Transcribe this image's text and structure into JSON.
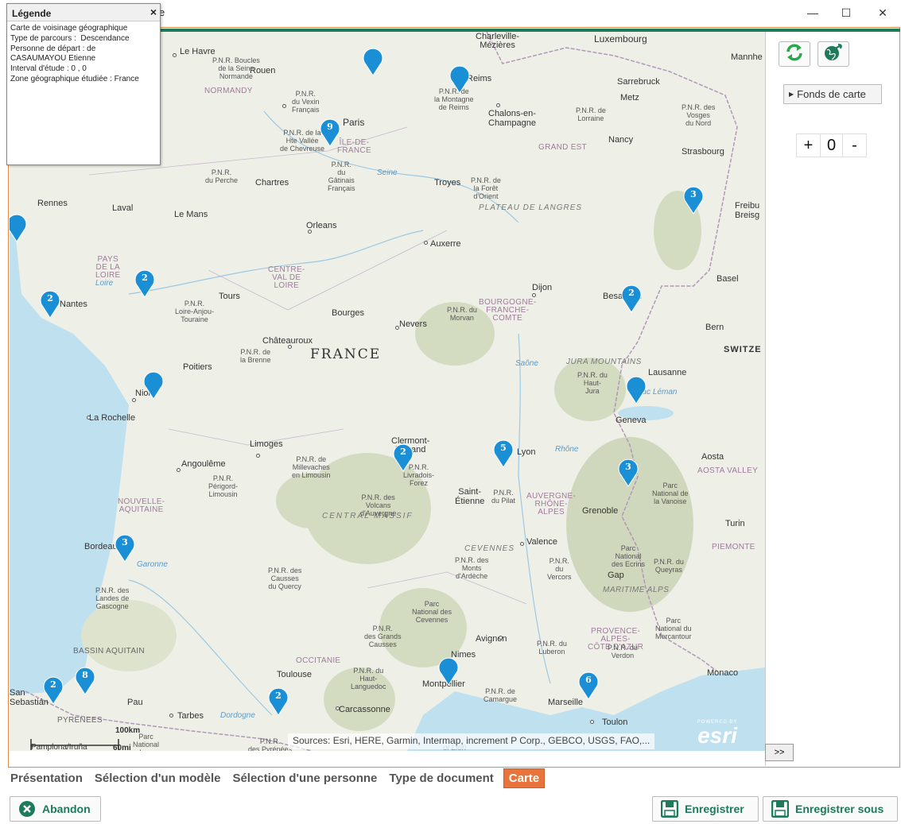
{
  "window": {
    "title_fragment": "e",
    "controls": {
      "minimize": "—",
      "maximize": "☐",
      "close": "✕"
    }
  },
  "legend": {
    "title": "Légende",
    "close": "×",
    "lines": [
      "Carte de voisinage géographique",
      "Type de parcours :  Descendance",
      "Personne de départ : de",
      "CASAUMAYOU Etienne",
      "Interval d'étude : 0 , 0",
      "Zone géographique étudiée : France"
    ]
  },
  "map": {
    "country_label": "FRANCE",
    "neighbour_label": "SWITZE",
    "cities": [
      {
        "name": "Charleville-\nMézières"
      },
      {
        "name": "Luxembourg"
      },
      {
        "name": "Le Havre"
      },
      {
        "name": "Rouen"
      },
      {
        "name": "Reims"
      },
      {
        "name": "Sarrebruck"
      },
      {
        "name": "Mannhe"
      },
      {
        "name": "Metz"
      },
      {
        "name": "Chalons-en-\nChampagne"
      },
      {
        "name": "Paris"
      },
      {
        "name": "Nancy"
      },
      {
        "name": "Strasbourg"
      },
      {
        "name": "Chartres"
      },
      {
        "name": "Troyes"
      },
      {
        "name": "Rennes"
      },
      {
        "name": "Laval"
      },
      {
        "name": "Le Mans"
      },
      {
        "name": "Orleans"
      },
      {
        "name": "Freibu\nBreisg"
      },
      {
        "name": "Auxerre"
      },
      {
        "name": "Basel"
      },
      {
        "name": "Nantes"
      },
      {
        "name": "Tours"
      },
      {
        "name": "Dijon"
      },
      {
        "name": "Besançon"
      },
      {
        "name": "Bourges"
      },
      {
        "name": "Nevers"
      },
      {
        "name": "Bern"
      },
      {
        "name": "Châteauroux"
      },
      {
        "name": "Poitiers"
      },
      {
        "name": "Lausanne"
      },
      {
        "name": "Niort"
      },
      {
        "name": "La Rochelle"
      },
      {
        "name": "Geneva"
      },
      {
        "name": "Limoges"
      },
      {
        "name": "Clermont-\nFerrand"
      },
      {
        "name": "Lyon"
      },
      {
        "name": "Angoulême"
      },
      {
        "name": "Saint-\nÉtienne"
      },
      {
        "name": "Aosta"
      },
      {
        "name": "Grenoble"
      },
      {
        "name": "Turin"
      },
      {
        "name": "Bordeaux"
      },
      {
        "name": "Valence"
      },
      {
        "name": "Gap"
      },
      {
        "name": "Avignon"
      },
      {
        "name": "Nimes"
      },
      {
        "name": "Monaco"
      },
      {
        "name": "Toulouse"
      },
      {
        "name": "Montpellier"
      },
      {
        "name": "Pau"
      },
      {
        "name": "Marseille"
      },
      {
        "name": "Carcassonne"
      },
      {
        "name": "Toulon"
      },
      {
        "name": "Tarbes"
      },
      {
        "name": "San\nSebastián"
      },
      {
        "name": "Pamplona/Iruña"
      },
      {
        "name": "Nantes-left"
      }
    ],
    "regions": [
      "NORMANDY",
      "ÎLE-DE-\nFRANCE",
      "GRAND EST",
      "PAYS\nDE LA\nLOIRE",
      "CENTRE-\nVAL DE\nLOIRE",
      "BOURGOGNE-\nFRANCHE-\nCOMTE",
      "NOUVELLE-\nAQUITAINE",
      "AUVERGNE-\nRHÔNE-\nALPES",
      "OCCITANIE",
      "PROVENCE-\nALPES-\nCÔTE D'AZUR",
      "AOSTA VALLEY",
      "PIEMONTE",
      "PYRENEES",
      "BASSIN AQUITAIN"
    ],
    "features": [
      "PLATEAU DE LANGRES",
      "CENTRAL  MASSIF",
      "JURA MOUNTAINS",
      "CEVENNES",
      "MARITIME ALPS",
      "Seine",
      "Loire",
      "Garonne",
      "Saône",
      "Rhône",
      "Dordogne",
      "Lac Léman"
    ],
    "parks": [
      "P.N.R. Boucles\nde la Seine\nNormande",
      "P.N.R.\ndu Vexin\nFrançais",
      "P.N.R. de\nla Montagne\nde Reims",
      "P.N.R. de\nLorraine",
      "P.N.R. des\nVosges\ndu Nord",
      "P.N.R. de la\nHte Vallée\nde Chevreuse",
      "P.N.R.\ndu Perche",
      "P.N.R.\ndu\nGâtinais\nFrançais",
      "P.N.R. de\nla Forêt\nd'Orient",
      "P.N.R.\nLoire-Anjou-\nTouraine",
      "P.N.R. du\nMorvan",
      "P.N.R. de\nla Brenne",
      "P.N.R. du\nHaut-\nJura",
      "P.N.R. de\nMillevaches\nen Limousin",
      "P.N.R.\nLivradois-\nForez",
      "P.N.R.\nPérigord-\nLimousin",
      "P.N.R. des\nVolcans\nd'Auvergne",
      "P.N.R.\ndu Pilat",
      "Parc\nNational de\nla Vanoise",
      "P.N.R. des\nMonts\nd'Ardèche",
      "P.N.R.\ndu\nVercors",
      "Parc\nNational\ndes Ecrins",
      "P.N.R. du\nQueyras",
      "P.N.R. des\nCausses\ndu Quercy",
      "P.N.R. des\nLandes de\nGascogne",
      "Parc\nNational des\nCevennes",
      "P.N.R.\ndes Grands\nCausses",
      "P.N.R. du\nLuberon",
      "P.N.R. du\nVerdon",
      "Parc\nNational du\nMercantour",
      "P.N.R. du\nHaut-\nLanguedoc",
      "P.N.R. de\nCamargue",
      "P.N.R.\ndes Pyrénées",
      "Parc\nNational\ndes..."
    ],
    "markers": [
      {
        "label": ""
      },
      {
        "label": ""
      },
      {
        "label": "9"
      },
      {
        "label": "3"
      },
      {
        "label": ""
      },
      {
        "label": "2"
      },
      {
        "label": "2"
      },
      {
        "label": "2"
      },
      {
        "label": ""
      },
      {
        "label": ""
      },
      {
        "label": "5"
      },
      {
        "label": "2"
      },
      {
        "label": "3"
      },
      {
        "label": "3"
      },
      {
        "label": "8"
      },
      {
        "label": "2"
      },
      {
        "label": ""
      },
      {
        "label": "2"
      },
      {
        "label": "6"
      }
    ],
    "attribution": "Sources: Esri, HERE, Garmin, Intermap, increment P Corp., GEBCO, USGS, FAO,...",
    "esri": {
      "powered": "POWERED BY",
      "logo": "esri"
    },
    "scale": {
      "km": "100km",
      "mi": "60mi"
    },
    "sea_label": "ol Lion"
  },
  "right_panel": {
    "refresh_icon": "refresh-icon",
    "export_icon": "globe-arrow-icon",
    "fonds_label": "Fonds de carte",
    "zoom": {
      "plus": "+",
      "level": "0",
      "minus": "-"
    },
    "expand_label": ">>"
  },
  "tabs": [
    {
      "label": "Présentation",
      "active": false
    },
    {
      "label": "Sélection d'un modèle",
      "active": false
    },
    {
      "label": "Sélection d'une personne",
      "active": false
    },
    {
      "label": "Type de document",
      "active": false
    },
    {
      "label": "Carte",
      "active": true
    }
  ],
  "buttons": {
    "abandon": "Abandon",
    "save": "Enregistrer",
    "save_as": "Enregistrer sous"
  },
  "colors": {
    "accent": "#1d7a5a",
    "active_tab": "#e8743b",
    "marker": "#1a8fd6",
    "sea": "#bfe0ef"
  }
}
